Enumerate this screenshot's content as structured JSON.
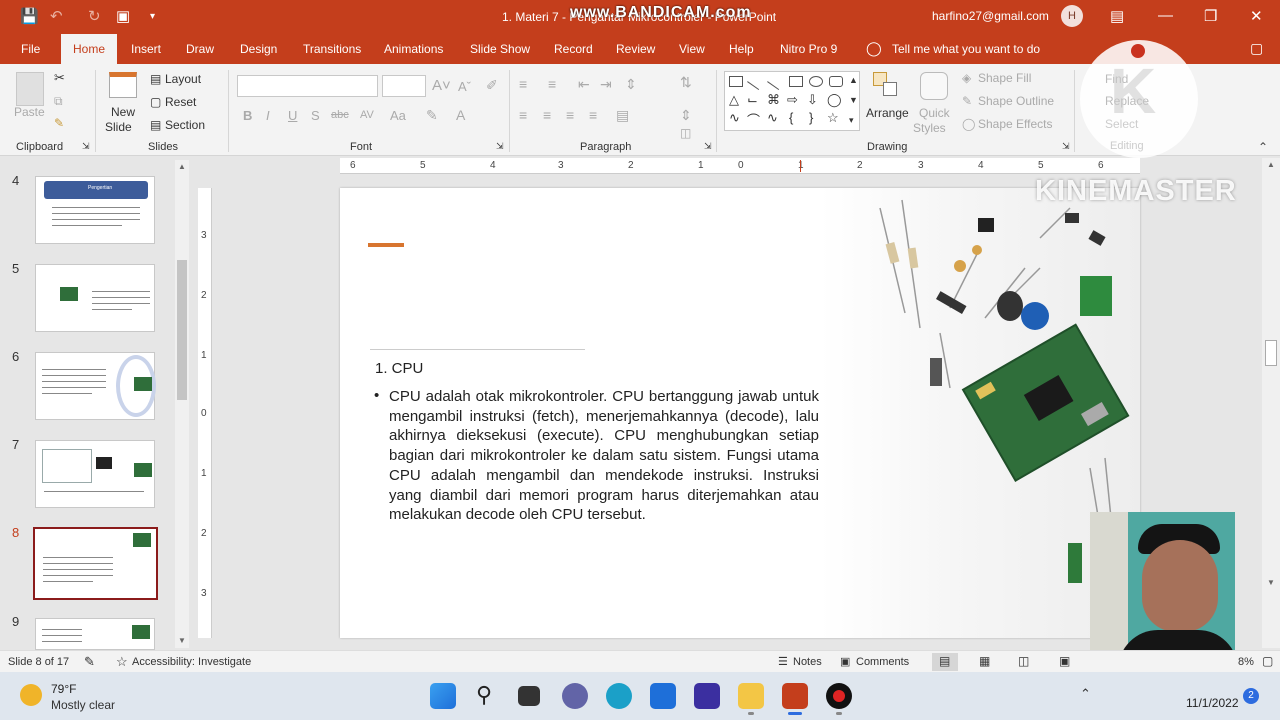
{
  "window": {
    "title": "1. Materi 7 - Pengantar Mikrocontroler - PowerPoint",
    "watermark": "www.BANDICAM.com",
    "user_email": "harfino27@gmail.com",
    "user_initial": "H"
  },
  "tabs": [
    "File",
    "Home",
    "Insert",
    "Draw",
    "Design",
    "Transitions",
    "Animations",
    "Slide Show",
    "Record",
    "Review",
    "View",
    "Help",
    "Nitro Pro 9"
  ],
  "tell_me": "Tell me what you want to do",
  "ribbon": {
    "clipboard": {
      "paste": "Paste",
      "label": "Clipboard"
    },
    "slides": {
      "new_slide_1": "New",
      "new_slide_2": "Slide",
      "layout": "Layout",
      "reset": "Reset",
      "section": "Section",
      "label": "Slides"
    },
    "font": {
      "label": "Font",
      "bold": "B",
      "italic": "I",
      "underline": "U",
      "shadow": "S",
      "strike": "abc",
      "spacing": "AV",
      "case": "Aa"
    },
    "paragraph": {
      "label": "Paragraph"
    },
    "drawing": {
      "arrange": "Arrange",
      "quick_1": "Quick",
      "quick_2": "Styles",
      "shape_fill": "Shape Fill",
      "shape_outline": "Shape Outline",
      "shape_effects": "Shape Effects",
      "label": "Drawing"
    },
    "editing": {
      "find": "Find",
      "replace": "Replace",
      "select": "Select",
      "label": "Editing"
    }
  },
  "ruler": {
    "h": [
      "6",
      "5",
      "4",
      "3",
      "2",
      "1",
      "0",
      "1",
      "2",
      "3",
      "4",
      "5",
      "6"
    ],
    "v": [
      "3",
      "2",
      "1",
      "0",
      "1",
      "2",
      "3"
    ]
  },
  "thumbnails": [
    {
      "num": "4",
      "title": "Pengertian"
    },
    {
      "num": "5"
    },
    {
      "num": "6"
    },
    {
      "num": "7"
    },
    {
      "num": "8",
      "selected": true
    },
    {
      "num": "9"
    }
  ],
  "slide": {
    "heading": "1. CPU",
    "bullet": "•",
    "body": "CPU adalah otak mikrokontroler. CPU bertanggung jawab untuk mengambil instruksi (fetch), menerjemahkannya (decode), lalu akhirnya dieksekusi (execute). CPU menghubungkan setiap bagian dari mikrokontroler ke dalam satu sistem. Fungsi utama CPU adalah mengambil dan mendekode instruksi. Instruksi yang diambil dari memori program harus diterjemahkan atau melakukan decode oleh CPU tersebut."
  },
  "overlay": {
    "kinemaster": "KINEMASTER"
  },
  "status": {
    "slide_count": "Slide 8 of 17",
    "accessibility": "Accessibility: Investigate",
    "notes": "Notes",
    "comments": "Comments",
    "zoom": "8%"
  },
  "taskbar": {
    "temp": "79°F",
    "weather": "Mostly clear",
    "date": "11/1/2022",
    "notif": "2"
  },
  "colors": {
    "accent": "#c43e1c",
    "selection": "#8b1b1b",
    "slide_accent": "#d8752f"
  }
}
